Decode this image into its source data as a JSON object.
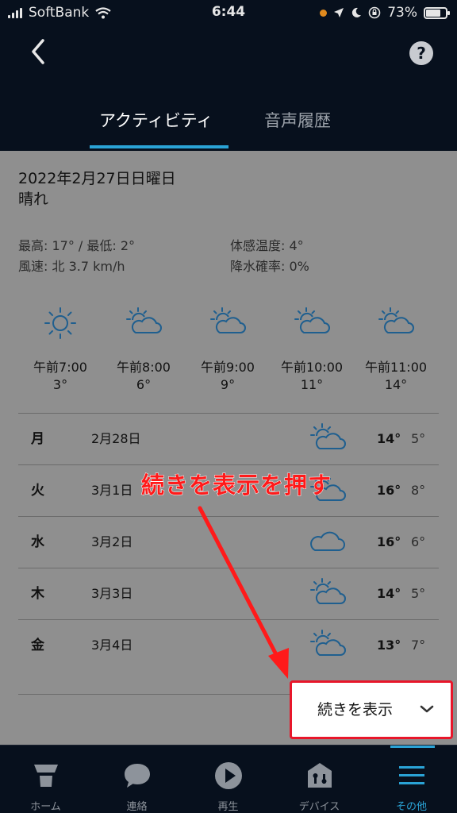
{
  "status_bar": {
    "carrier": "SoftBank",
    "time": "6:44",
    "battery": "73%",
    "battery_level": 0.73
  },
  "header": {
    "back_icon": "chevron-left-icon",
    "help_label": "?",
    "tabs": [
      {
        "label": "アクティビティ",
        "active": true
      },
      {
        "label": "音声履歴",
        "active": false
      }
    ]
  },
  "weather": {
    "date": "2022年2月27日日曜日",
    "condition": "晴れ",
    "high_low": "最高: 17° / 最低: 2°",
    "wind": "風速: 北  3.7 km/h",
    "feels_like": "体感温度: 4°",
    "precip": "降水確率: 0%",
    "hourly": [
      {
        "time": "午前7:00",
        "temp": "3°",
        "icon": "sun-icon"
      },
      {
        "time": "午前8:00",
        "temp": "6°",
        "icon": "partly-cloudy-icon"
      },
      {
        "time": "午前9:00",
        "temp": "9°",
        "icon": "partly-cloudy-icon"
      },
      {
        "time": "午前10:00",
        "temp": "11°",
        "icon": "partly-cloudy-icon"
      },
      {
        "time": "午前11:00",
        "temp": "14°",
        "icon": "partly-cloudy-icon"
      }
    ],
    "daily": [
      {
        "dow": "月",
        "date": "2月28日",
        "icon": "partly-cloudy-icon",
        "high": "14°",
        "low": "5°"
      },
      {
        "dow": "火",
        "date": "3月1日",
        "icon": "partly-cloudy-icon",
        "high": "16°",
        "low": "8°"
      },
      {
        "dow": "水",
        "date": "3月2日",
        "icon": "cloud-icon",
        "high": "16°",
        "low": "6°"
      },
      {
        "dow": "木",
        "date": "3月3日",
        "icon": "partly-cloudy-icon",
        "high": "14°",
        "low": "5°"
      },
      {
        "dow": "金",
        "date": "3月4日",
        "icon": "partly-cloudy-icon",
        "high": "13°",
        "low": "7°"
      }
    ],
    "show_more_label": "続きを表示"
  },
  "annotation": {
    "text": "続きを表示を押す",
    "color": "#ff1a1a"
  },
  "bottom_nav": [
    {
      "label": "ホーム",
      "icon": "home-icon",
      "active": false
    },
    {
      "label": "連絡",
      "icon": "chat-bubble-icon",
      "active": false
    },
    {
      "label": "再生",
      "icon": "play-icon",
      "active": false
    },
    {
      "label": "デバイス",
      "icon": "devices-icon",
      "active": false
    },
    {
      "label": "その他",
      "icon": "menu-icon",
      "active": true
    }
  ],
  "colors": {
    "accent": "#2aa3d6",
    "background": "#07101d",
    "highlight_box": "#e8162a"
  }
}
